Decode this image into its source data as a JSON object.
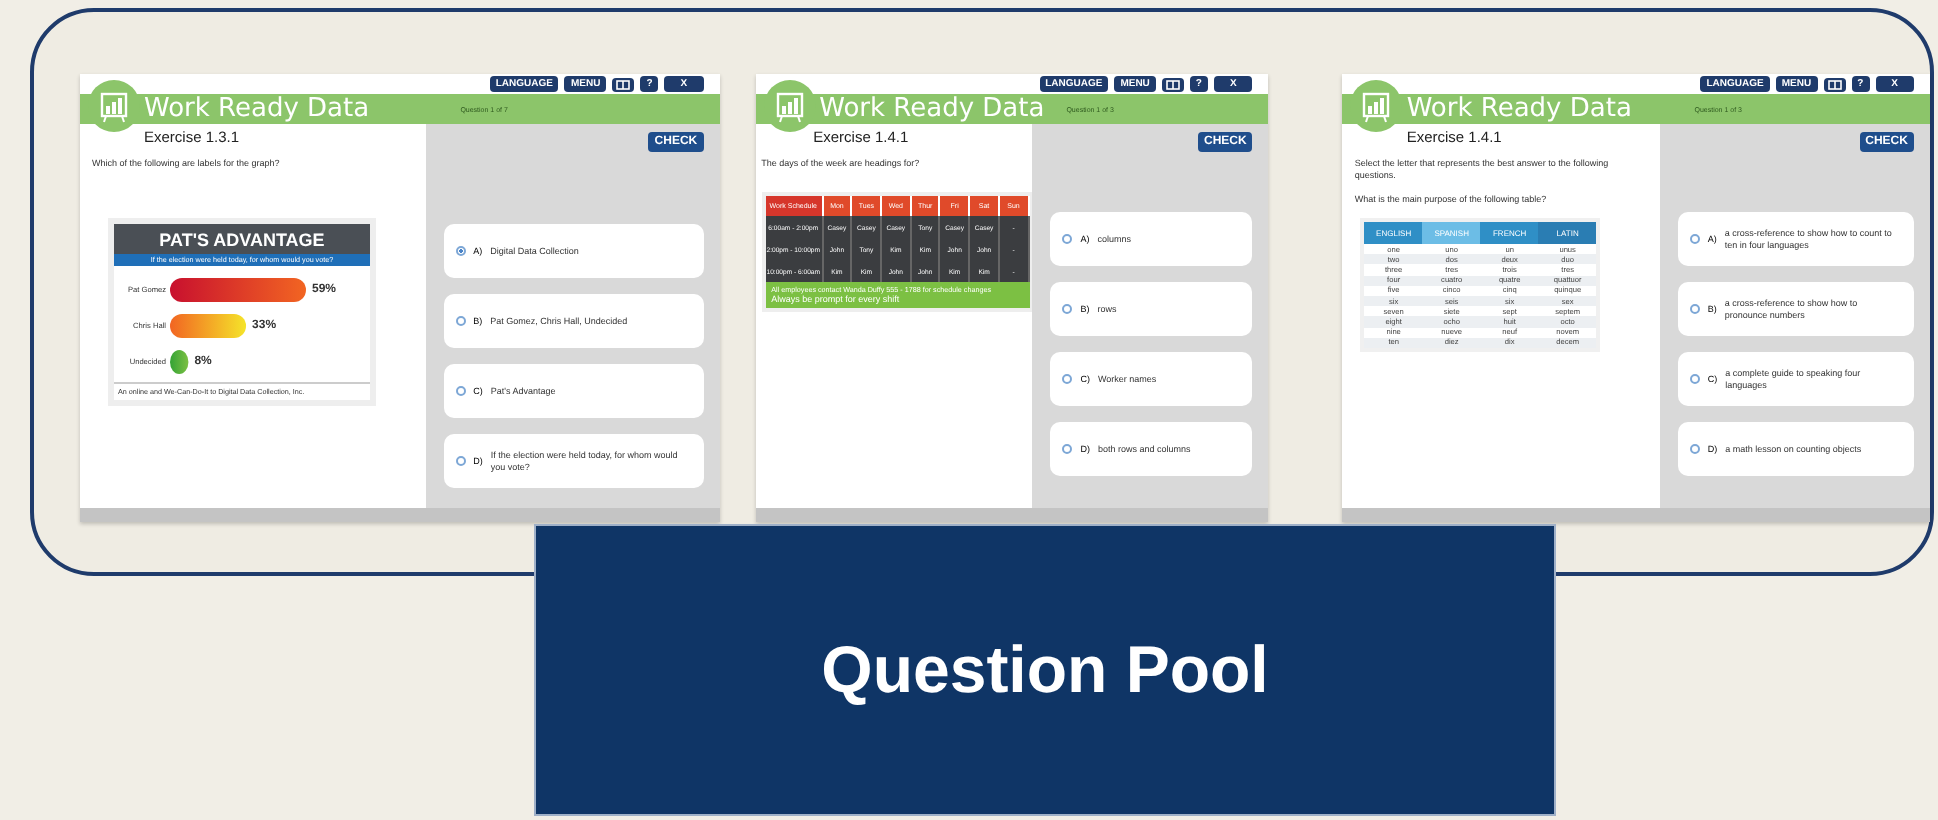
{
  "panels": [
    {
      "toolbar": [
        {
          "kind": "text",
          "label": "LANGUAGE"
        },
        {
          "kind": "text",
          "label": "MENU"
        },
        {
          "kind": "icon"
        },
        {
          "kind": "text",
          "label": "?"
        },
        {
          "kind": "text",
          "label": "X"
        }
      ],
      "title": "Work Ready Data",
      "counter": "Question 1 of 7",
      "exercise": "Exercise 1.3.1",
      "prompts": [
        "Which of the following are labels for the graph?"
      ],
      "check": "CHECK",
      "figure": {
        "kind": "bar_chart",
        "subtitle": "If the election were held today, for whom would you vote?",
        "footer": "An online and We-Can-Do-It to Digital Data Collection, Inc.",
        "chart_data": {
          "type": "bar",
          "title": "PAT'S ADVANTAGE",
          "orientation": "horizontal",
          "categories": [
            "Pat Gomez",
            "Chris Hall",
            "Undecided"
          ],
          "values": [
            59,
            33,
            8
          ],
          "value_labels": [
            "59%",
            "33%",
            "8%"
          ]
        }
      },
      "options": [
        {
          "letter": "A)",
          "text": "Digital Data Collection",
          "selected": true
        },
        {
          "letter": "B)",
          "text": "Pat Gomez, Chris Hall, Undecided",
          "selected": false
        },
        {
          "letter": "C)",
          "text": "Pat's Advantage",
          "selected": false
        },
        {
          "letter": "D)",
          "text": "If the election were held today, for whom would you vote?",
          "selected": false
        }
      ]
    },
    {
      "toolbar": [
        {
          "kind": "text",
          "label": "LANGUAGE"
        },
        {
          "kind": "text",
          "label": "MENU"
        },
        {
          "kind": "icon"
        },
        {
          "kind": "text",
          "label": "?"
        },
        {
          "kind": "text",
          "label": "X"
        }
      ],
      "title": "Work Ready Data",
      "counter": "Question 1 of 3",
      "exercise": "Exercise 1.4.1",
      "prompts": [
        "The days of the week are headings for?"
      ],
      "check": "CHECK",
      "figure": {
        "kind": "schedule",
        "header": [
          "Work Schedule",
          "Mon",
          "Tues",
          "Wed",
          "Thur",
          "Fri",
          "Sat",
          "Sun"
        ],
        "rows": [
          [
            "6:00am - 2:00pm",
            "Casey",
            "Casey",
            "Casey",
            "Tony",
            "Casey",
            "Casey",
            "-"
          ],
          [
            "2:00pm - 10:00pm",
            "John",
            "Tony",
            "Kim",
            "Kim",
            "John",
            "John",
            "-"
          ],
          [
            "10:00pm - 6:00am",
            "Kim",
            "Kim",
            "John",
            "John",
            "Kim",
            "Kim",
            "-"
          ]
        ],
        "note": "All employees contact Wanda Duffy 555 - 1788 for schedule changes",
        "motto": "Always be prompt for every shift"
      },
      "options": [
        {
          "letter": "A)",
          "text": "columns",
          "selected": false
        },
        {
          "letter": "B)",
          "text": "rows",
          "selected": false
        },
        {
          "letter": "C)",
          "text": "Worker names",
          "selected": false
        },
        {
          "letter": "D)",
          "text": "both rows and columns",
          "selected": false
        }
      ]
    },
    {
      "toolbar": [
        {
          "kind": "text",
          "label": "LANGUAGE"
        },
        {
          "kind": "text",
          "label": "MENU"
        },
        {
          "kind": "icon"
        },
        {
          "kind": "text",
          "label": "?"
        },
        {
          "kind": "text",
          "label": "X"
        }
      ],
      "title": "Work Ready Data",
      "counter": "Question 1 of 3",
      "exercise": "Exercise 1.4.1",
      "prompts": [
        "Select the letter that represents the best answer to the following questions.",
        "What is the main purpose of the following table?"
      ],
      "check": "CHECK",
      "figure": {
        "kind": "language_table",
        "header": [
          "ENGLISH",
          "SPANISH",
          "FRENCH",
          "LATIN"
        ],
        "rows": [
          [
            "one",
            "uno",
            "un",
            "unus"
          ],
          [
            "two",
            "dos",
            "deux",
            "duo"
          ],
          [
            "three",
            "tres",
            "trois",
            "tres"
          ],
          [
            "four",
            "cuatro",
            "quatre",
            "quattuor"
          ],
          [
            "five",
            "cinco",
            "cinq",
            "quinque"
          ],
          [
            "six",
            "seis",
            "six",
            "sex"
          ],
          [
            "seven",
            "siete",
            "sept",
            "septem"
          ],
          [
            "eight",
            "ocho",
            "huit",
            "octo"
          ],
          [
            "nine",
            "nueve",
            "neuf",
            "novem"
          ],
          [
            "ten",
            "diez",
            "dix",
            "decem"
          ]
        ]
      },
      "options": [
        {
          "letter": "A)",
          "text": "a cross-reference to show how to count to ten in four languages",
          "selected": false
        },
        {
          "letter": "B)",
          "text": "a cross-reference to show how to pronounce numbers",
          "selected": false
        },
        {
          "letter": "C)",
          "text": "a complete guide to speaking four languages",
          "selected": false
        },
        {
          "letter": "D)",
          "text": "a math lesson on counting objects",
          "selected": false
        }
      ]
    }
  ],
  "banner": {
    "title": "Question Pool"
  }
}
